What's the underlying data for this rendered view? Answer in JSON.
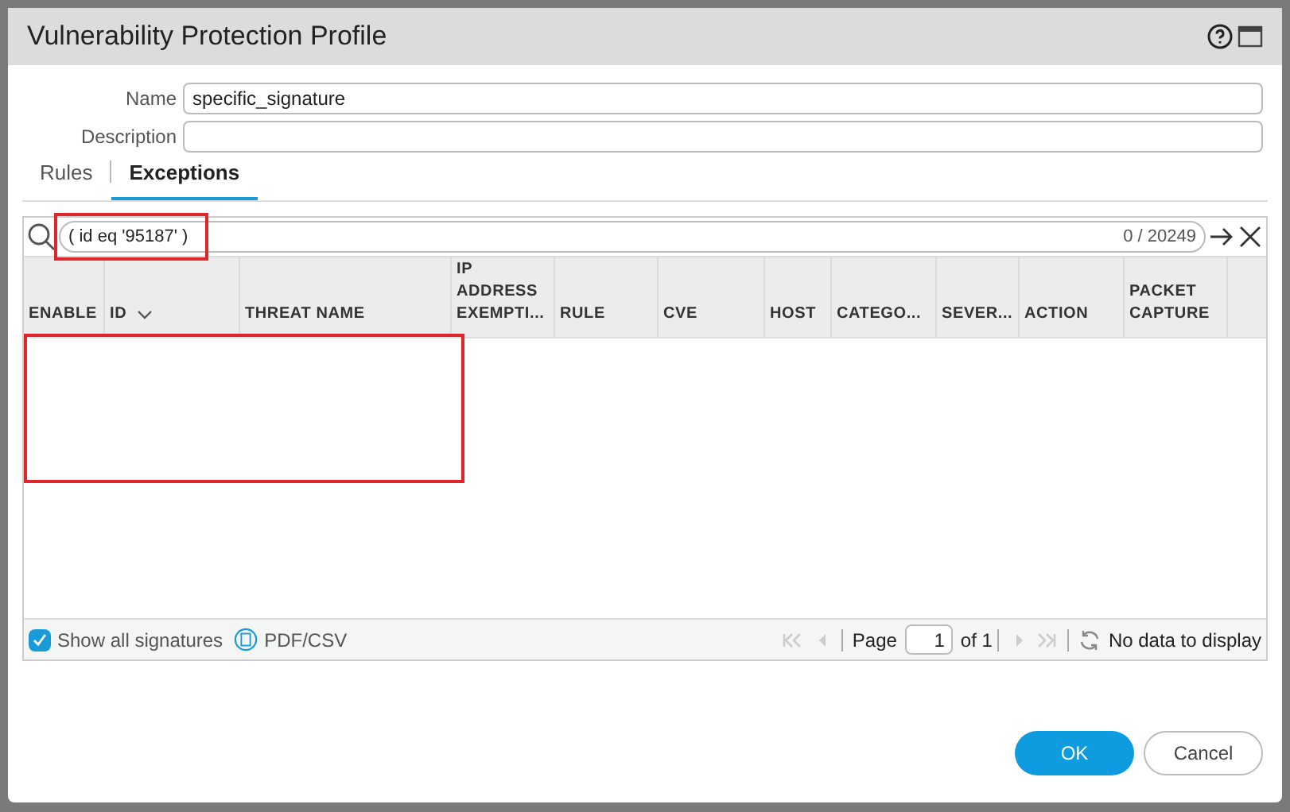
{
  "window": {
    "title": "Vulnerability Protection Profile"
  },
  "fields": [
    {
      "label": "Name",
      "value": "specific_signature"
    },
    {
      "label": "Description"
    }
  ],
  "tabs": [
    {
      "label": "Rules",
      "selected": false
    },
    {
      "label": "Exceptions",
      "selected": true
    }
  ],
  "filter": {
    "value": "( id eq '95187' )",
    "count": "0 / 20249",
    "highlighted": true
  },
  "table": {
    "columns": [
      {
        "label": "ENABLE"
      },
      {
        "label": "ID",
        "sorted": true
      },
      {
        "label": "THREAT NAME"
      },
      {
        "label": "IP ADDRESS EXEMPTI..."
      },
      {
        "label": "RULE"
      },
      {
        "label": "CVE"
      },
      {
        "label": "HOST"
      },
      {
        "label": "CATEGO..."
      },
      {
        "label": "SEVER..."
      },
      {
        "label": "ACTION"
      },
      {
        "label": "PACKET CAPTURE"
      }
    ],
    "empty_area_highlighted": true
  },
  "footer": {
    "show_all": {
      "label": "Show all signatures",
      "checked": true
    },
    "export": "PDF/CSV",
    "page_label": "Page",
    "page": "1",
    "of": "of 1",
    "status": "No data to display"
  },
  "buttons": [
    {
      "label": "OK",
      "kind": "primary"
    },
    {
      "label": "Cancel",
      "kind": "secondary"
    }
  ]
}
